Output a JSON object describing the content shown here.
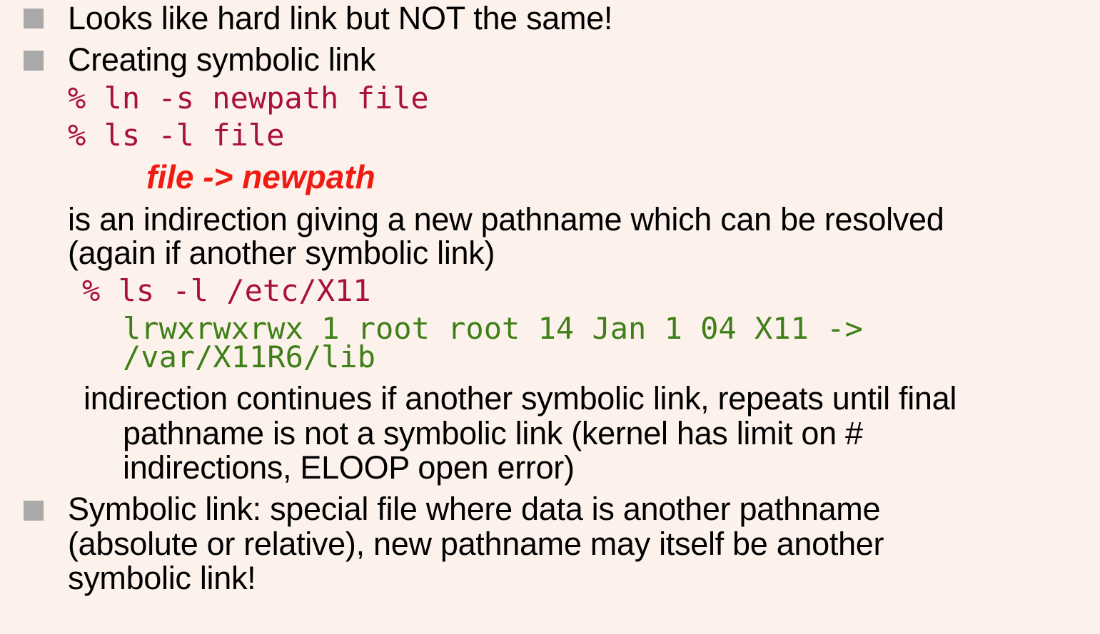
{
  "slide": {
    "bullets": [
      {
        "text": "Looks like hard link but NOT the same!"
      },
      {
        "text": "Creating symbolic link"
      },
      {
        "lines": [
          "Symbolic link: special file where data is another pathname",
          "(absolute or relative), new pathname may itself be another",
          "symbolic link!"
        ]
      }
    ],
    "commands": {
      "ln": "% ln -s newpath file",
      "ls_file": "% ls -l file",
      "result": "file -> newpath",
      "ls_x11": "% ls -l /etc/X11"
    },
    "explanation": {
      "lines": [
        "is an indirection giving a new pathname which can be resolved",
        "(again if another symbolic link)"
      ]
    },
    "ls_output": {
      "lines": [
        "lrwxrwxrwx 1 root root 14 Jan 1 04 X11 ->",
        "/var/X11R6/lib"
      ]
    },
    "continuation": {
      "lines": [
        "indirection continues if another symbolic link, repeats until final",
        "pathname is not a symbolic link (kernel has limit on #",
        "indirections, ELOOP open error)"
      ]
    },
    "colors": {
      "background": "#fdf1ec",
      "bullet": "#a9a9a9",
      "command": "#a8103f",
      "output": "#3f7f18",
      "highlight": "#ee1c12"
    }
  }
}
